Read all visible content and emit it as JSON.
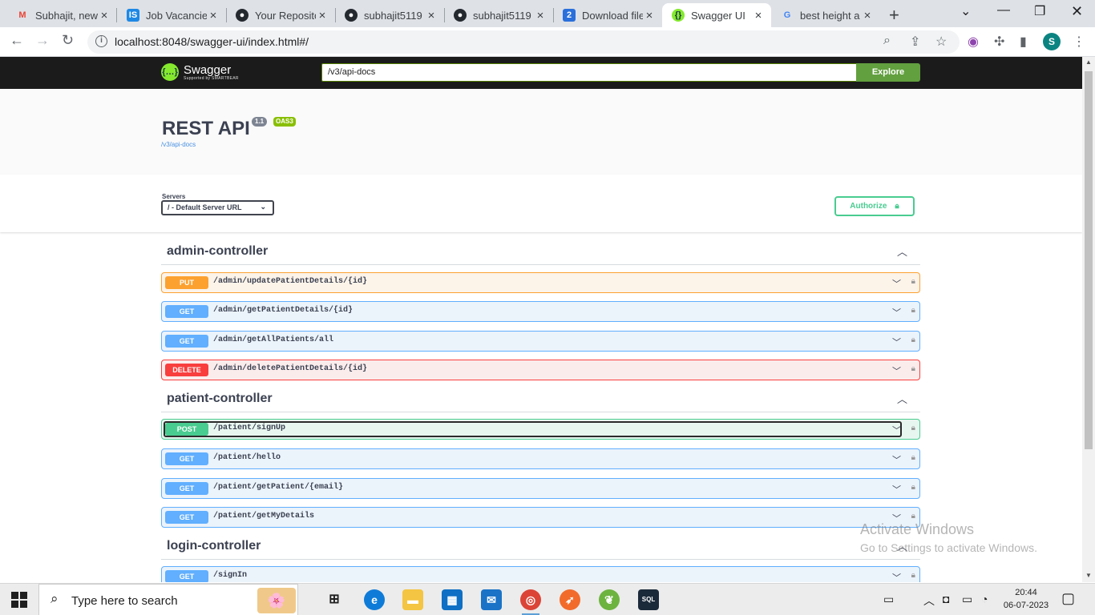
{
  "browser": {
    "tabs": [
      {
        "label": "Subhajit, new",
        "icon": "gmail-icon"
      },
      {
        "label": "Job Vacancies",
        "icon": "is-icon"
      },
      {
        "label": "Your Reposito",
        "icon": "github-icon"
      },
      {
        "label": "subhajit5119",
        "icon": "github-icon"
      },
      {
        "label": "subhajit5119",
        "icon": "github-icon"
      },
      {
        "label": "Download file",
        "icon": "doc-icon"
      },
      {
        "label": "Swagger UI",
        "icon": "swagger-icon"
      },
      {
        "label": "best height a",
        "icon": "google-icon"
      }
    ],
    "active_tab": 6,
    "url": "localhost:8048/swagger-ui/index.html#/",
    "profile_initial": "S"
  },
  "swagger": {
    "logo_text": "Swagger",
    "logo_sub": "Supported by SMARTBEAR",
    "spec_url": "/v3/api-docs",
    "explore_label": "Explore",
    "title": "REST API",
    "version": "1.1",
    "oas_badge": "OAS3",
    "spec_link": "/v3/api-docs",
    "servers_label": "Servers",
    "server_selected": "/ - Default Server URL",
    "authorize_label": "Authorize"
  },
  "controllers": {
    "admin": {
      "name": "admin-controller",
      "ops": [
        {
          "method": "PUT",
          "path": "/admin/updatePatientDetails/{id}"
        },
        {
          "method": "GET",
          "path": "/admin/getPatientDetails/{id}"
        },
        {
          "method": "GET",
          "path": "/admin/getAllPatients/all"
        },
        {
          "method": "DELETE",
          "path": "/admin/deletePatientDetails/{id}"
        }
      ]
    },
    "patient": {
      "name": "patient-controller",
      "ops": [
        {
          "method": "POST",
          "path": "/patient/signUp"
        },
        {
          "method": "GET",
          "path": "/patient/hello"
        },
        {
          "method": "GET",
          "path": "/patient/getPatient/{email}"
        },
        {
          "method": "GET",
          "path": "/patient/getMyDetails"
        }
      ]
    },
    "login": {
      "name": "login-controller",
      "ops": [
        {
          "method": "GET",
          "path": "/signIn"
        }
      ]
    }
  },
  "watermark": {
    "line1": "Activate Windows",
    "line2": "Go to Settings to activate Windows."
  },
  "taskbar": {
    "search_placeholder": "Type here to search",
    "time": "20:44",
    "date": "06-07-2023"
  },
  "colors": {
    "put": "#fca130",
    "get": "#61affe",
    "delete": "#f93e3e",
    "post": "#49cc90",
    "explore": "#62a03f",
    "topbar": "#1b1b1b"
  }
}
